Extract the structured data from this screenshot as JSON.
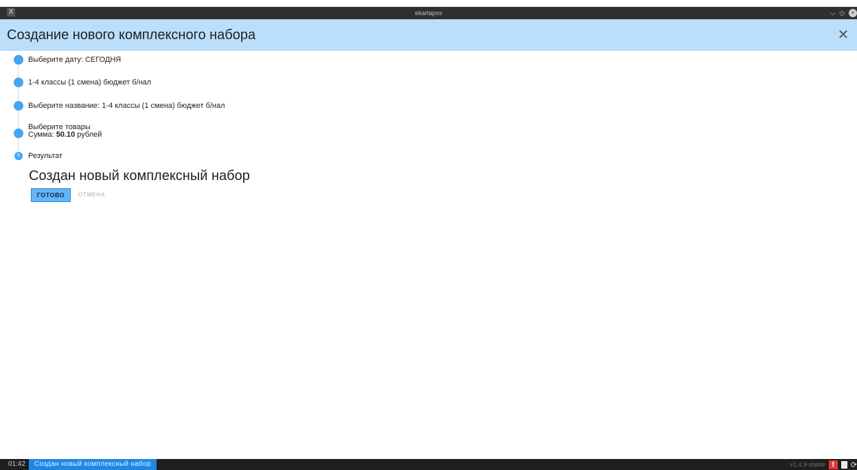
{
  "window": {
    "title": "ekartapos",
    "app_icon": "X",
    "controls": {
      "minimize": "⌵",
      "maximize": "◇",
      "close": "×"
    }
  },
  "header": {
    "title": "Создание нового комплексного набора",
    "close_icon": "✕"
  },
  "steps": [
    {
      "text": "Выберите дату: СЕГОДНЯ"
    },
    {
      "text": "1-4 классы (1 смена) бюджет б/нал"
    },
    {
      "text": "Выберите название: 1-4 классы (1 смена) бюджет б/нал"
    },
    {
      "line1": "Выберите товары",
      "sum_label": "Сумма:",
      "sum_value": "50.10",
      "sum_unit": "рублей"
    },
    {
      "number": "5",
      "text": "Результат"
    }
  ],
  "result": {
    "message": "Создан новый комплексный набор",
    "done_label": "ГОТОВО",
    "cancel_label": "ОТМЕНА"
  },
  "statusbar": {
    "time": "01:42",
    "message": "Создан новый комплексный набор",
    "version": "v1.4.9-stable",
    "warn_icon": "!",
    "sync_icon": "⟳"
  },
  "colors": {
    "header_bg": "#bbdefb",
    "accent": "#42a5f5",
    "button_bg": "#64b5f6",
    "status_msg_bg": "#1e88e5"
  }
}
